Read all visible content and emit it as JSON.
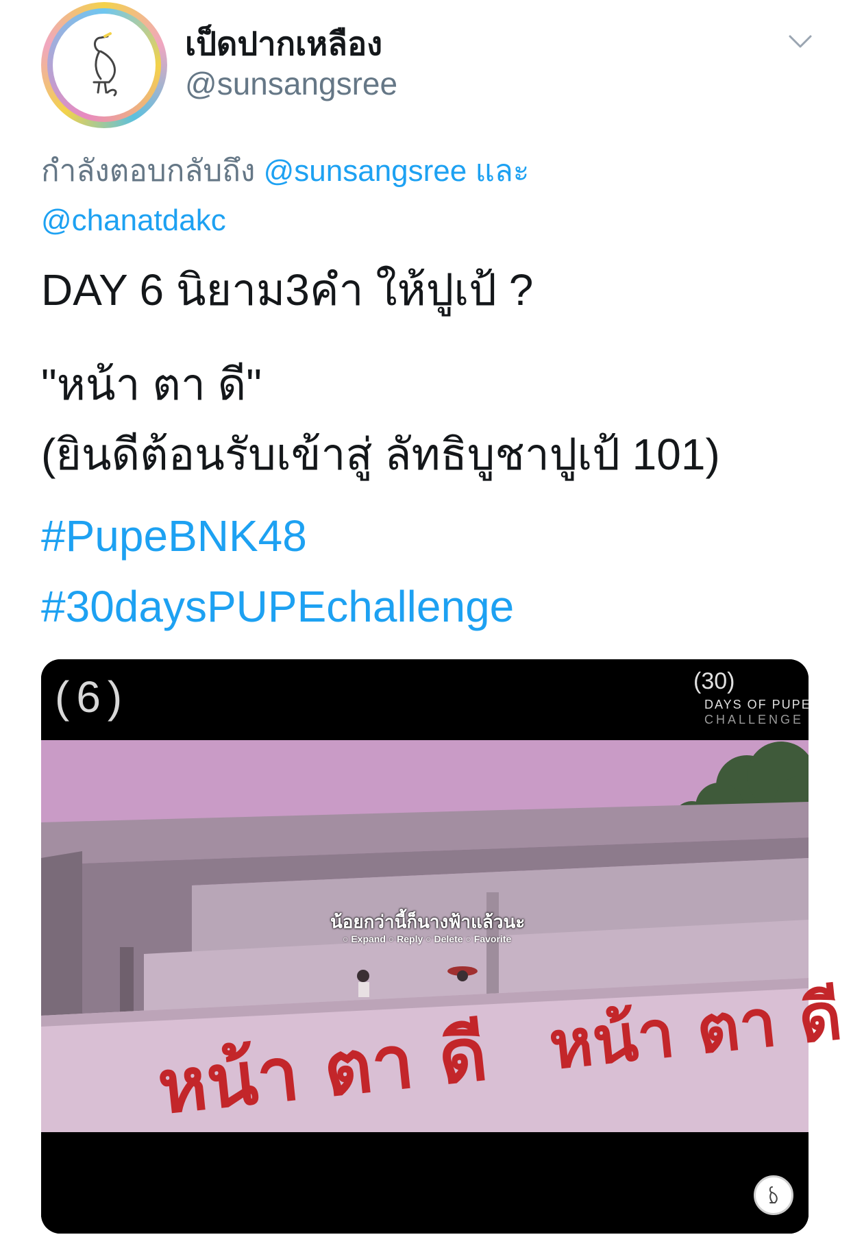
{
  "tweet": {
    "display_name": "เป็ดปากเหลือง",
    "handle": "@sunsangsree",
    "reply_prefix": "กำลังตอบกลับถึง",
    "reply_mention_1": "@sunsangsree",
    "reply_and": "และ",
    "reply_mention_2": "@chanatdakc",
    "line1": "DAY 6 นิยาม3คำ ให้ปูเป้ ?",
    "line2": "\"หน้า ตา ดี\"",
    "line3": "(ยินดีต้อนรับเข้าสู่ ลัทธิบูชาปูเป้ 101)",
    "hashtag1": "#PupeBNK48",
    "hashtag2": "#30daysPUPEchallenge"
  },
  "media": {
    "counter": "(6)",
    "logo_num": "(30)",
    "logo_line1": "DAYS OF PUPE",
    "logo_line2": "CHALLENGE",
    "subtitle": "น้อยกว่านี้ก็นางฟ้าแล้วนะ",
    "options": "○ Expand ○ Reply ○ Delete ○ Favorite",
    "wall_text_left": "หน้า ตา ดี",
    "wall_text_right": "หน้า ตา ดี"
  },
  "icons": {
    "chevron": "chevron-down-icon",
    "avatar": "duck-avatar",
    "watermark": "duck-watermark"
  },
  "colors": {
    "link": "#1da1f2",
    "secondary": "#657786",
    "sky": "#c99bc6",
    "wall_text": "#c3262a"
  }
}
